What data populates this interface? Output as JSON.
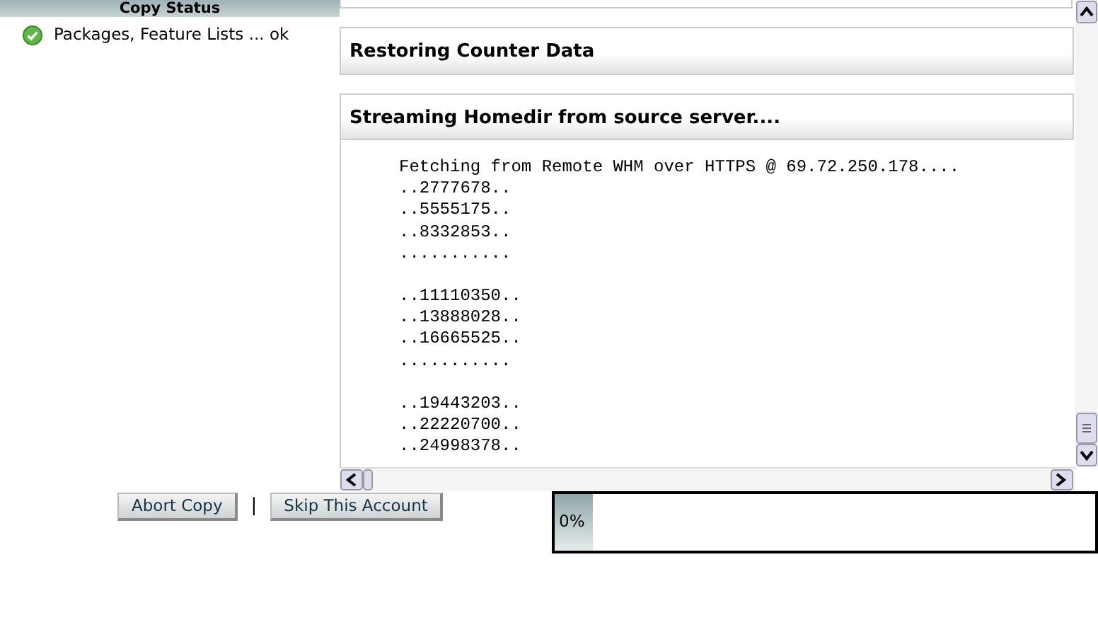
{
  "copy_status": {
    "title": "Copy Status",
    "items": [
      {
        "text": "Packages, Feature Lists ... ok",
        "kind": "ok"
      }
    ]
  },
  "sections": [
    {
      "title": "Restoring Counter Data"
    },
    {
      "title": "Streaming Homedir from source server....",
      "log_groups": [
        [
          "Fetching from Remote WHM over HTTPS @ 69.72.250.178....",
          "..2777678..",
          "..5555175..",
          "..8332853..",
          "..........."
        ],
        [
          "..11110350..",
          "..13888028..",
          "..16665525..",
          "..........."
        ],
        [
          "..19443203..",
          "..22220700..",
          "..24998378.."
        ]
      ]
    }
  ],
  "buttons": [
    "Abort Copy",
    "Skip This Account"
  ],
  "separator": "|",
  "progress": {
    "level": 0.07,
    "reading": "0%"
  }
}
